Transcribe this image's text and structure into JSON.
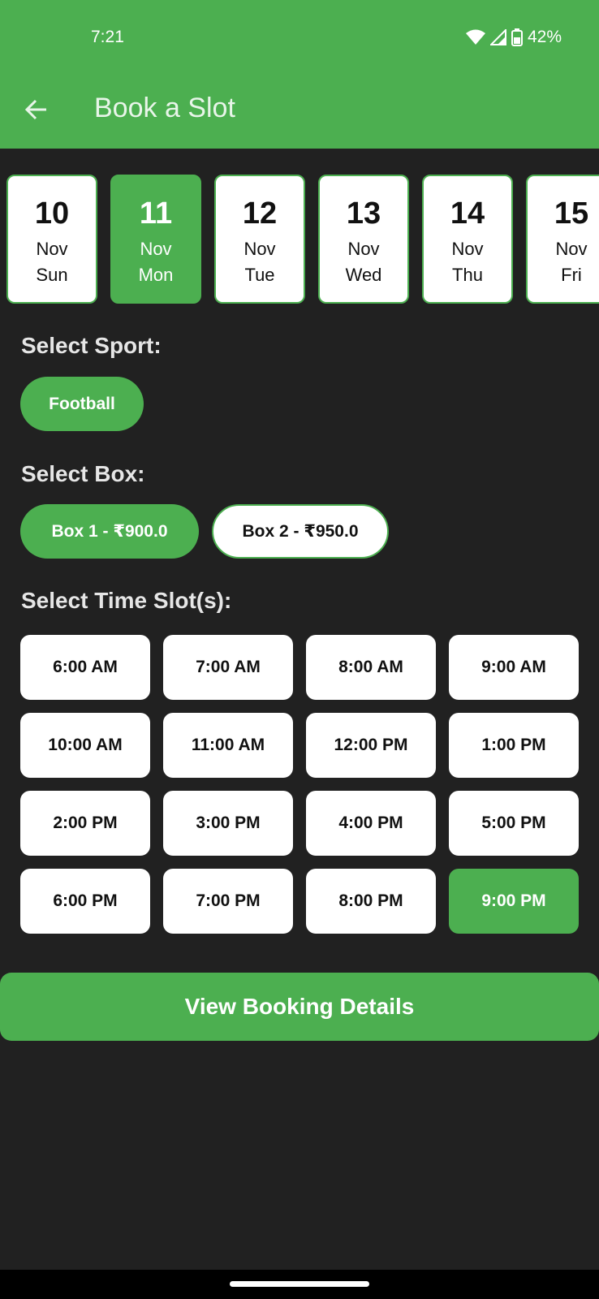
{
  "status": {
    "time": "7:21",
    "battery": "42%"
  },
  "header": {
    "title": "Book a Slot"
  },
  "dates": [
    {
      "day": "10",
      "month": "Nov",
      "weekday": "Sun",
      "selected": false
    },
    {
      "day": "11",
      "month": "Nov",
      "weekday": "Mon",
      "selected": true
    },
    {
      "day": "12",
      "month": "Nov",
      "weekday": "Tue",
      "selected": false
    },
    {
      "day": "13",
      "month": "Nov",
      "weekday": "Wed",
      "selected": false
    },
    {
      "day": "14",
      "month": "Nov",
      "weekday": "Thu",
      "selected": false
    },
    {
      "day": "15",
      "month": "Nov",
      "weekday": "Fri",
      "selected": false
    }
  ],
  "sport": {
    "label": "Select Sport:",
    "options": [
      {
        "label": "Football",
        "selected": true
      }
    ]
  },
  "box": {
    "label": "Select Box:",
    "options": [
      {
        "label": "Box 1 - ₹900.0",
        "selected": true
      },
      {
        "label": "Box 2 - ₹950.0",
        "selected": false
      }
    ]
  },
  "slots": {
    "label": "Select Time Slot(s):",
    "items": [
      {
        "label": "6:00 AM",
        "selected": false
      },
      {
        "label": "7:00 AM",
        "selected": false
      },
      {
        "label": "8:00 AM",
        "selected": false
      },
      {
        "label": "9:00 AM",
        "selected": false
      },
      {
        "label": "10:00 AM",
        "selected": false
      },
      {
        "label": "11:00 AM",
        "selected": false
      },
      {
        "label": "12:00 PM",
        "selected": false
      },
      {
        "label": "1:00 PM",
        "selected": false
      },
      {
        "label": "2:00 PM",
        "selected": false
      },
      {
        "label": "3:00 PM",
        "selected": false
      },
      {
        "label": "4:00 PM",
        "selected": false
      },
      {
        "label": "5:00 PM",
        "selected": false
      },
      {
        "label": "6:00 PM",
        "selected": false
      },
      {
        "label": "7:00 PM",
        "selected": false
      },
      {
        "label": "8:00 PM",
        "selected": false
      },
      {
        "label": "9:00 PM",
        "selected": true
      }
    ]
  },
  "action": {
    "label": "View Booking Details"
  },
  "colors": {
    "accent": "#4caf50",
    "background": "#212121",
    "card": "#ffffff"
  },
  "icons": {
    "back": "arrow-left-icon",
    "wifi": "wifi-icon",
    "signal": "signal-icon",
    "battery": "battery-icon"
  }
}
